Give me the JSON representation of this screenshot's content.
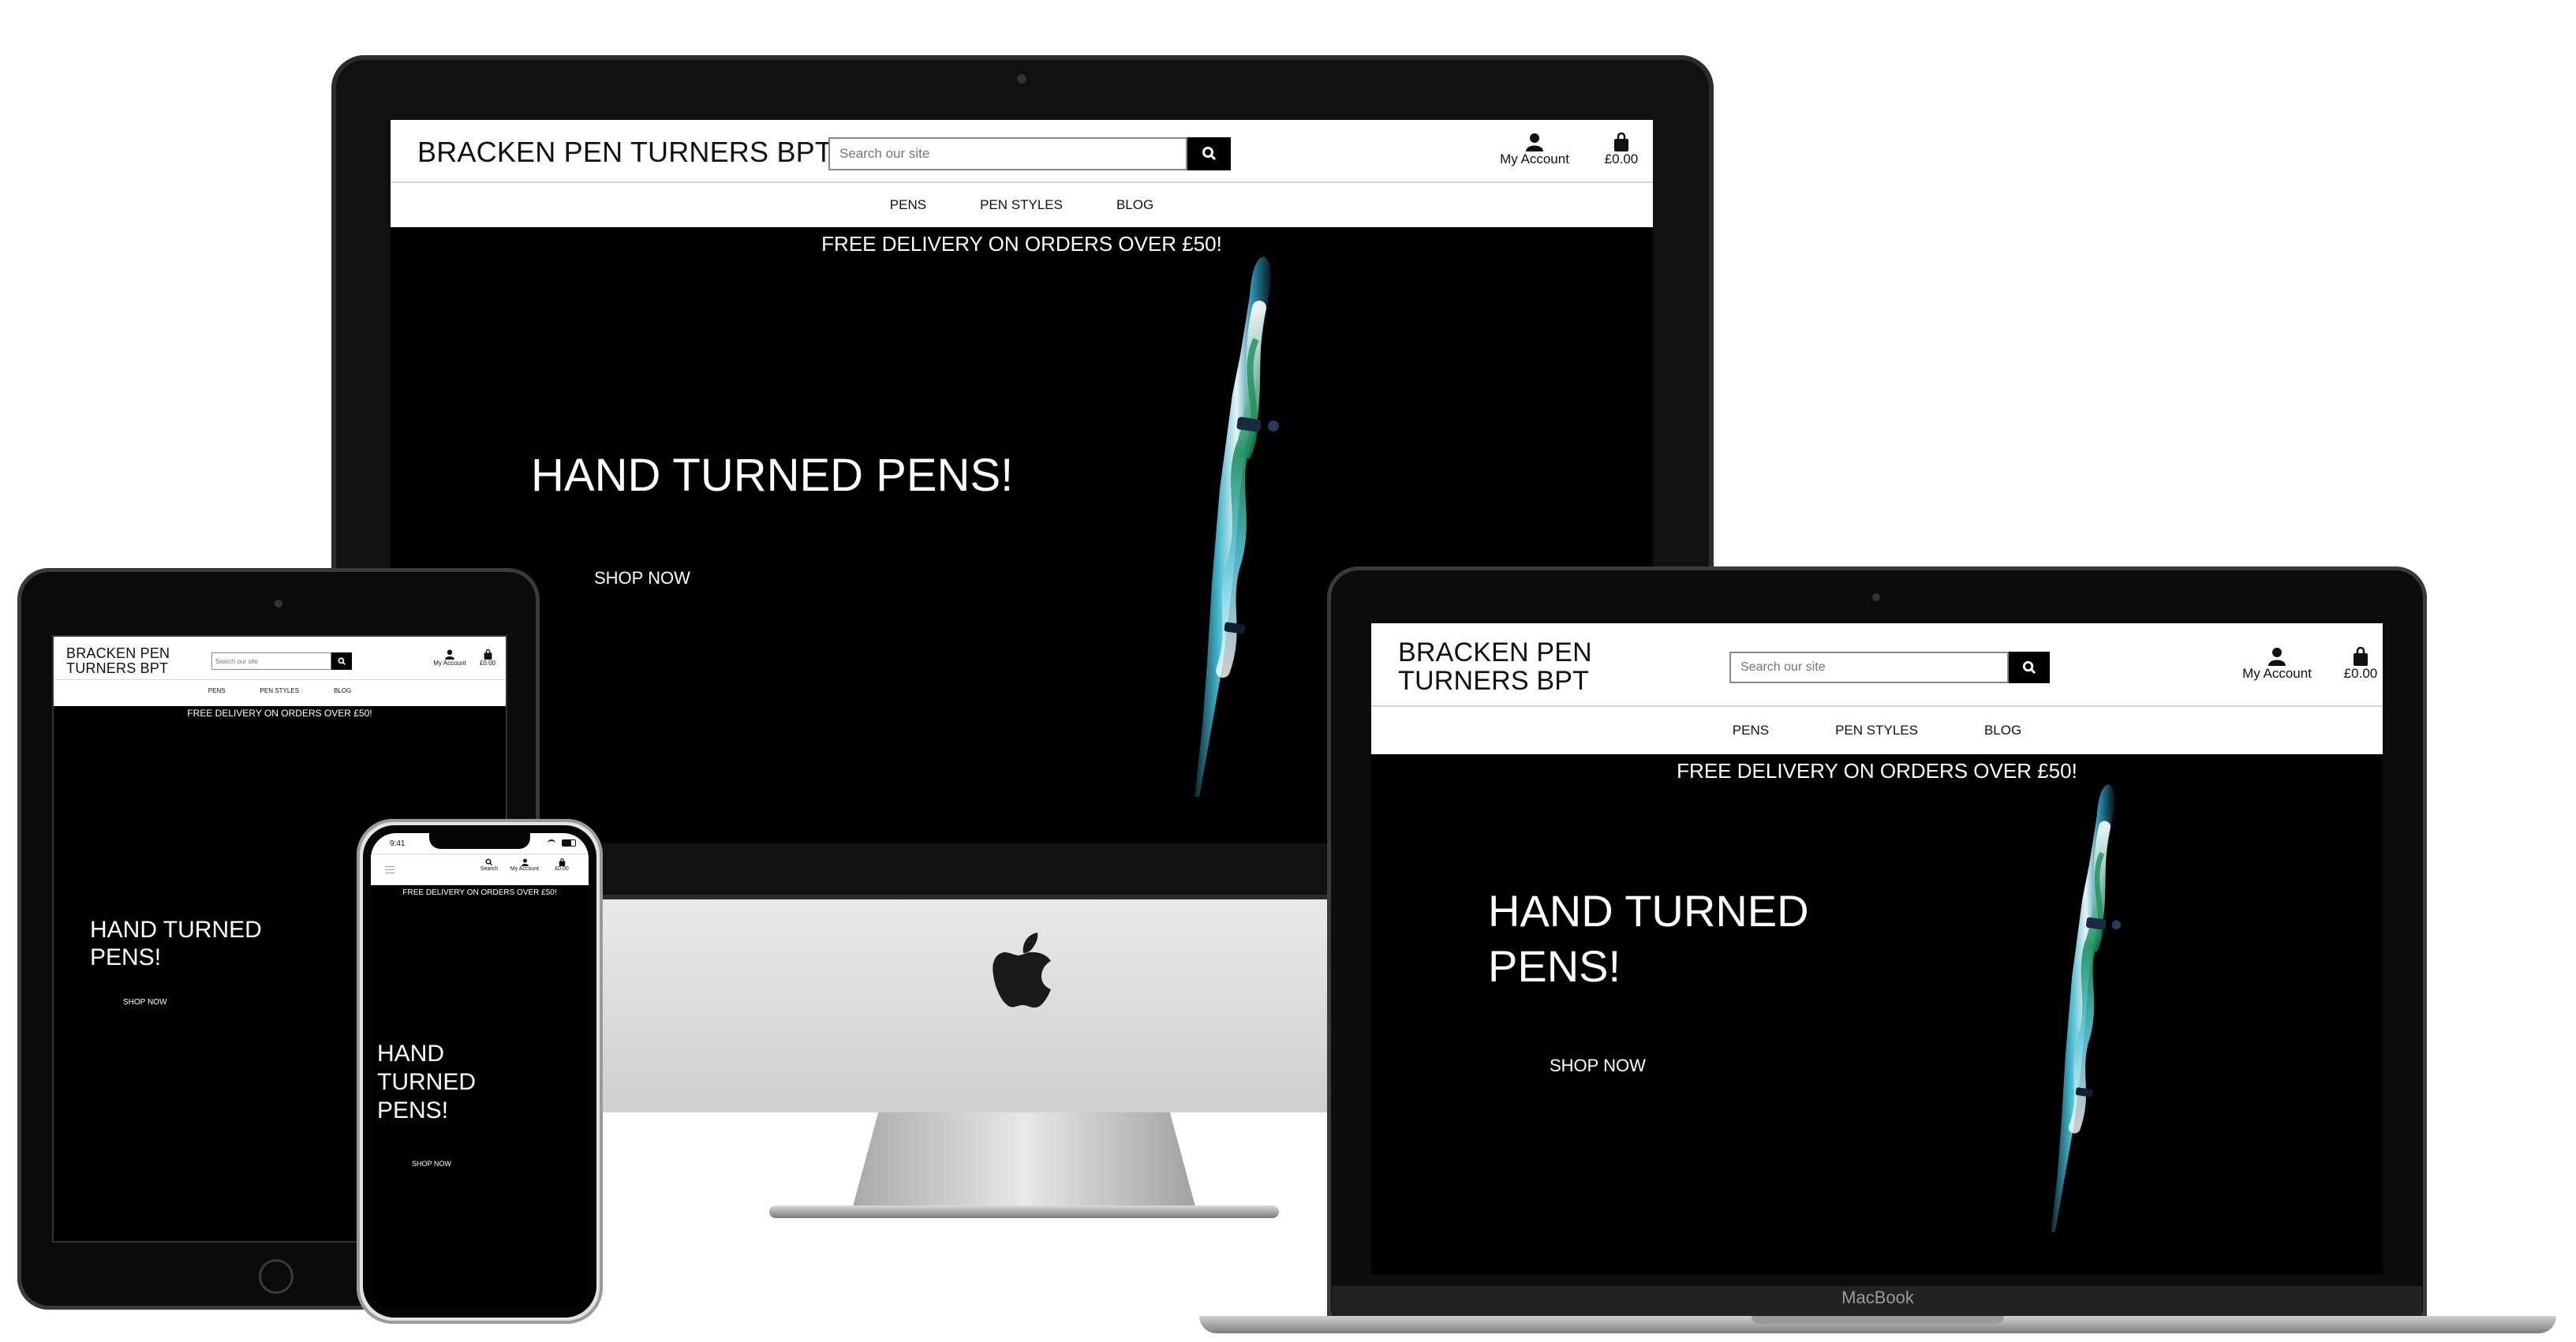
{
  "site": {
    "logo_main": "BRACKEN PEN TURNERS",
    "logo_short": "BPT",
    "logo_line1": "BRACKEN PEN",
    "logo_line2_main": "TURNERS",
    "search_placeholder": "Search our site",
    "account_label": "My Account",
    "bag_total": "£0.00",
    "search_label": "Search",
    "nav": [
      "PENS",
      "PEN STYLES",
      "BLOG"
    ],
    "banner": "FREE DELIVERY ON ORDERS OVER £50!",
    "hero_title": "HAND TURNED PENS!",
    "hero_line1": "HAND TURNED",
    "hero_line2": "PENS!",
    "phone_hero": [
      "HAND",
      "TURNED",
      "PENS!"
    ],
    "shop_now": "SHOP NOW"
  },
  "devices": {
    "laptop_brand": "MacBook",
    "phone_time": "9:41"
  },
  "colors": {
    "page_bg": "#ffffff",
    "screen_bg": "#000000",
    "header_bg": "#ffffff",
    "search_button": "#000000",
    "pen_blue": "#3fb4c9",
    "pen_green": "#1e8f5e"
  }
}
